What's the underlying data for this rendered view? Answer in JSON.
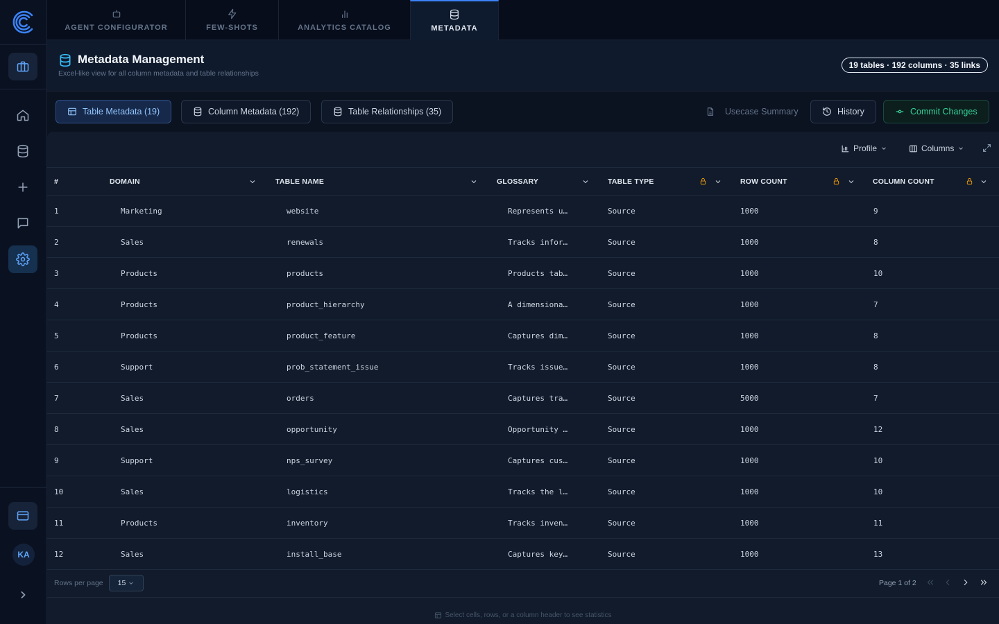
{
  "sidebar": {
    "avatar_initials": "KA"
  },
  "top_tabs": [
    {
      "label": "AGENT CONFIGURATOR",
      "icon": "bot-icon"
    },
    {
      "label": "FEW-SHOTS",
      "icon": "bolt-icon"
    },
    {
      "label": "ANALYTICS CATALOG",
      "icon": "bar-chart-icon"
    },
    {
      "label": "METADATA",
      "icon": "database-icon",
      "active": true
    }
  ],
  "header": {
    "title": "Metadata Management",
    "subtitle": "Excel-like view for all column metadata and table relationships",
    "badge": "19 tables · 192 columns · 35 links"
  },
  "toolbar": {
    "tab_table": "Table Metadata (19)",
    "tab_column": "Column Metadata (192)",
    "tab_relationships": "Table Relationships (35)",
    "usecase_summary": "Usecase Summary",
    "history": "History",
    "commit": "Commit Changes"
  },
  "panel_tools": {
    "profile": "Profile",
    "columns": "Columns"
  },
  "table": {
    "headers": {
      "num": "#",
      "domain": "DOMAIN",
      "table_name": "TABLE NAME",
      "glossary": "GLOSSARY",
      "table_type": "TABLE TYPE",
      "row_count": "ROW COUNT",
      "column_count": "COLUMN COUNT"
    },
    "rows": [
      {
        "num": "1",
        "domain": "Marketing",
        "table_name": "website",
        "glossary": "Represents u…",
        "table_type": "Source",
        "row_count": "1000",
        "column_count": "9"
      },
      {
        "num": "2",
        "domain": "Sales",
        "table_name": "renewals",
        "glossary": "Tracks infor…",
        "table_type": "Source",
        "row_count": "1000",
        "column_count": "8"
      },
      {
        "num": "3",
        "domain": "Products",
        "table_name": "products",
        "glossary": "Products tab…",
        "table_type": "Source",
        "row_count": "1000",
        "column_count": "10"
      },
      {
        "num": "4",
        "domain": "Products",
        "table_name": "product_hierarchy",
        "glossary": "A dimensiona…",
        "table_type": "Source",
        "row_count": "1000",
        "column_count": "7"
      },
      {
        "num": "5",
        "domain": "Products",
        "table_name": "product_feature",
        "glossary": "Captures dim…",
        "table_type": "Source",
        "row_count": "1000",
        "column_count": "8"
      },
      {
        "num": "6",
        "domain": "Support",
        "table_name": "prob_statement_issue",
        "glossary": "Tracks issue…",
        "table_type": "Source",
        "row_count": "1000",
        "column_count": "8"
      },
      {
        "num": "7",
        "domain": "Sales",
        "table_name": "orders",
        "glossary": "Captures tra…",
        "table_type": "Source",
        "row_count": "5000",
        "column_count": "7"
      },
      {
        "num": "8",
        "domain": "Sales",
        "table_name": "opportunity",
        "glossary": "Opportunity …",
        "table_type": "Source",
        "row_count": "1000",
        "column_count": "12"
      },
      {
        "num": "9",
        "domain": "Support",
        "table_name": "nps_survey",
        "glossary": "Captures cus…",
        "table_type": "Source",
        "row_count": "1000",
        "column_count": "10"
      },
      {
        "num": "10",
        "domain": "Sales",
        "table_name": "logistics",
        "glossary": "Tracks the l…",
        "table_type": "Source",
        "row_count": "1000",
        "column_count": "10"
      },
      {
        "num": "11",
        "domain": "Products",
        "table_name": "inventory",
        "glossary": "Tracks inven…",
        "table_type": "Source",
        "row_count": "1000",
        "column_count": "11"
      },
      {
        "num": "12",
        "domain": "Sales",
        "table_name": "install_base",
        "glossary": "Captures key…",
        "table_type": "Source",
        "row_count": "1000",
        "column_count": "13"
      }
    ]
  },
  "pagination": {
    "rows_per_page_label": "Rows per page",
    "rows_per_page_value": "15",
    "page_info": "Page 1 of 2"
  },
  "footer_hint": "Select cells, rows, or a column header to see statistics",
  "colors": {
    "accent": "#3b82f6",
    "commit": "#34d399",
    "lock": "#f59e0b"
  }
}
